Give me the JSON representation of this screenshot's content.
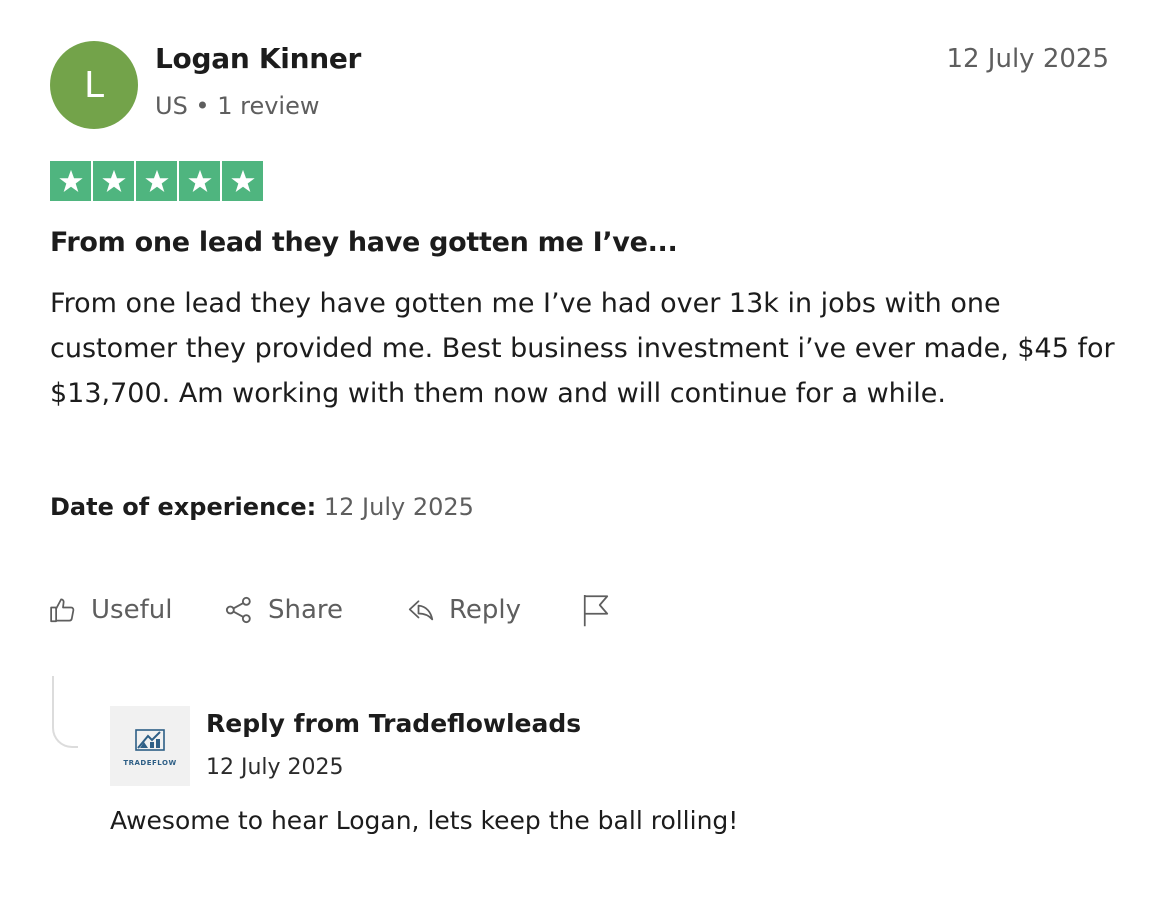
{
  "reviewer": {
    "avatar_initial": "L",
    "avatar_color": "#73a34a",
    "name": "Logan Kinner",
    "meta": "US • 1 review"
  },
  "review": {
    "date": "12 July 2025",
    "rating": 5,
    "rating_max": 5,
    "star_color": "#4fb57f",
    "title": "From one lead they have gotten me I’ve...",
    "body": "From one lead they have gotten me I’ve had over 13k in jobs with one customer they provided me. Best business investment i’ve ever made, $45 for $13,700. Am working with them now and will continue for a while.",
    "experience_label": "Date of experience:",
    "experience_date": "12 July 2025"
  },
  "actions": {
    "useful": {
      "label": "Useful",
      "icon": "thumbs-up-icon"
    },
    "share": {
      "label": "Share",
      "icon": "share-icon"
    },
    "reply": {
      "label": "Reply",
      "icon": "reply-arrow-icon"
    },
    "report": {
      "icon": "flag-icon"
    }
  },
  "company_reply": {
    "logo_icon": "tradeflow-logo",
    "logo_text": "TRADEFLOW",
    "title": "Reply from Tradeflowleads",
    "date": "12 July 2025",
    "body": "Awesome to hear Logan, lets keep the ball rolling!"
  }
}
